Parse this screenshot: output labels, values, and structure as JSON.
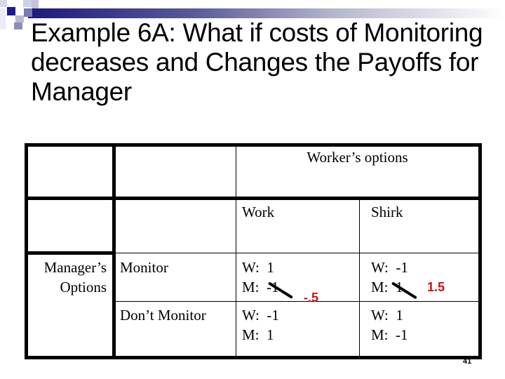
{
  "slide": {
    "title": "Example 6A: What if costs of Monitoring decreases and Changes the Payoffs for Manager",
    "slide_number": "41"
  },
  "table": {
    "column_group_header": "Worker’s options",
    "columns": [
      "Work",
      "Shirk"
    ],
    "row_group_header": [
      "Manager’s",
      "Options"
    ],
    "rows": [
      {
        "label": "Monitor",
        "cells": [
          {
            "worker": "W:  1",
            "manager": "M:  -1",
            "manager_struck": true,
            "revised_manager_payoff": "-.5"
          },
          {
            "worker": "W:  -1",
            "manager": "M:  1",
            "manager_struck": true,
            "revised_manager_payoff": "1.5"
          }
        ]
      },
      {
        "label": "Don’t Monitor",
        "cells": [
          {
            "worker": "W:  -1",
            "manager": "M:  1",
            "manager_struck": false
          },
          {
            "worker": "W:  1",
            "manager": "M:  -1",
            "manager_struck": false
          }
        ]
      }
    ]
  },
  "colors": {
    "revision_red": "#cc1111",
    "header_bar_dark": "#1a1a7a"
  }
}
